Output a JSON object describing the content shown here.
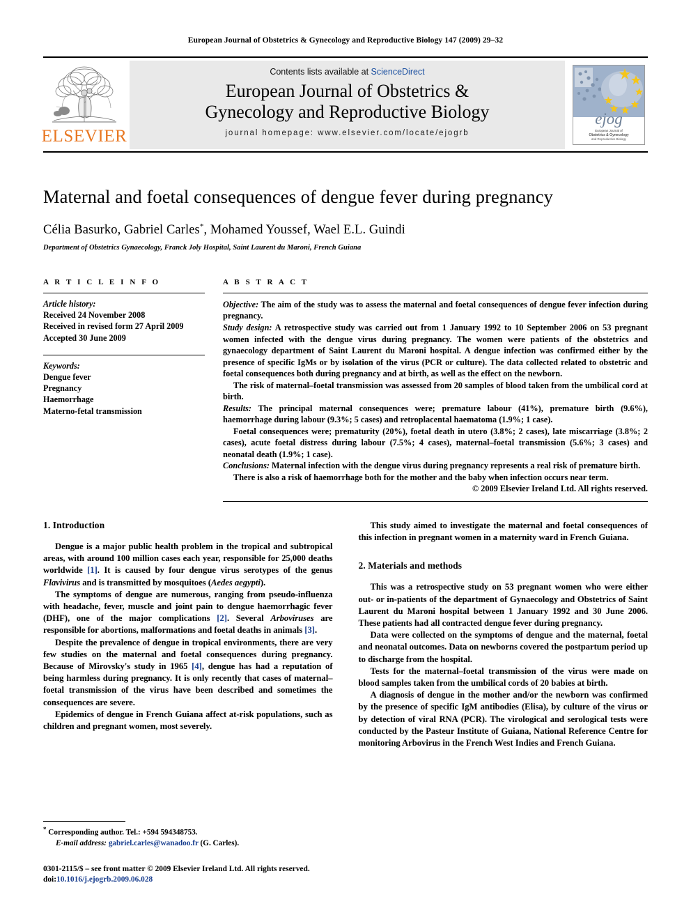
{
  "running_head": "European Journal of Obstetrics & Gynecology and Reproductive Biology 147 (2009) 29–32",
  "masthead": {
    "publisher_name": "ELSEVIER",
    "publisher_logo_icon": "elsevier-tree-logo",
    "contents_prefix": "Contents lists available at",
    "sciencedirect_label": "ScienceDirect",
    "journal_title": "European Journal of Obstetrics & Gynecology and Reproductive Biology",
    "homepage_label": "journal homepage: www.elsevier.com/locate/ejogrb",
    "cover_icon": "journal-cover-thumbnail",
    "cover_caption": "Obstetrics & Gynecology and Reproductive Biology",
    "cover_wordmark": "ejog"
  },
  "article": {
    "title": "Maternal and foetal consequences of dengue fever during pregnancy",
    "authors": "Célia Basurko, Gabriel Carles",
    "authors_marker": "*",
    "authors_rest": ", Mohamed Youssef, Wael E.L. Guindi",
    "affiliation": "Department of Obstetrics Gynaecology, Franck Joly Hospital, Saint Laurent du Maroni, French Guiana"
  },
  "article_info": {
    "heading": "A R T I C L E   I N F O",
    "history_label": "Article history:",
    "history": [
      "Received 24 November 2008",
      "Received in revised form 27 April 2009",
      "Accepted 30 June 2009"
    ],
    "keywords_label": "Keywords:",
    "keywords": [
      "Dengue fever",
      "Pregnancy",
      "Haemorrhage",
      "Materno-fetal transmission"
    ]
  },
  "abstract": {
    "heading": "A B S T R A C T",
    "objective_label": "Objective:",
    "objective_text": " The aim of the study was to assess the maternal and foetal consequences of dengue fever infection during pregnancy.",
    "study_design_label": "Study design:",
    "study_design_text": " A retrospective study was carried out from 1 January 1992 to 10 September 2006 on 53 pregnant women infected with the dengue virus during pregnancy. The women were patients of the obstetrics and gynaecology department of Saint Laurent du Maroni hospital. A dengue infection was confirmed either by the presence of specific IgMs or by isolation of the virus (PCR or culture). The data collected related to obstetric and foetal consequences both during pregnancy and at birth, as well as the effect on the newborn.",
    "study_design_para2": "The risk of maternal–foetal transmission was assessed from 20 samples of blood taken from the umbilical cord at birth.",
    "results_label": "Results:",
    "results_text": " The principal maternal consequences were; premature labour (41%), premature birth (9.6%), haemorrhage during labour (9.3%; 5 cases) and retroplacental haematoma (1.9%; 1 case).",
    "results_para2": "Foetal consequences were; prematurity (20%), foetal death in utero (3.8%; 2 cases), late miscarriage (3.8%; 2 cases), acute foetal distress during labour (7.5%; 4 cases), maternal–foetal transmission (5.6%; 3 cases) and neonatal death (1.9%; 1 case).",
    "conclusions_label": "Conclusions:",
    "conclusions_text": " Maternal infection with the dengue virus during pregnancy represents a real risk of premature birth.",
    "conclusions_para2": "There is also a risk of haemorrhage both for the mother and the baby when infection occurs near term.",
    "copyright": "© 2009 Elsevier Ireland Ltd. All rights reserved."
  },
  "body": {
    "left": {
      "section1_heading": "1. Introduction",
      "p1_a": "Dengue is a major public health problem in the tropical and subtropical areas, with around 100 million cases each year, responsible for 25,000 deaths worldwide ",
      "p1_ref": "[1]",
      "p1_b": ". It is caused by four dengue virus serotypes of the genus ",
      "p1_italic1": "Flavivirus",
      "p1_c": " and is transmitted by mosquitoes (",
      "p1_italic2": "Aedes aegypti",
      "p1_d": ").",
      "p2_a": "The symptoms of dengue are numerous, ranging from pseudo-influenza with headache, fever, muscle and joint pain to dengue haemorrhagic fever (DHF), one of the major complications ",
      "p2_ref": "[2]",
      "p2_b": ". Several ",
      "p2_italic": "Arboviruses",
      "p2_c": " are responsible for abortions, malformations and foetal deaths in animals ",
      "p2_ref2": "[3]",
      "p2_d": ".",
      "p3_a": "Despite the prevalence of dengue in tropical environments, there are very few studies on the maternal and foetal consequences during pregnancy. Because of Mirovsky's study in 1965 ",
      "p3_ref": "[4]",
      "p3_b": ", dengue has had a reputation of being harmless during pregnancy. It is only recently that cases of maternal–foetal transmission of the virus have been described and sometimes the consequences are severe.",
      "p4": "Epidemics of dengue in French Guiana affect at-risk populations, such as children and pregnant women, most severely."
    },
    "right": {
      "p1": "This study aimed to investigate the maternal and foetal consequences of this infection in pregnant women in a maternity ward in French Guiana.",
      "section2_heading": "2. Materials and methods",
      "p2": "This was a retrospective study on 53 pregnant women who were either out- or in-patients of the department of Gynaecology and Obstetrics of Saint Laurent du Maroni hospital between 1 January 1992 and 30 June 2006. These patients had all contracted dengue fever during pregnancy.",
      "p3": "Data were collected on the symptoms of dengue and the maternal, foetal and neonatal outcomes. Data on newborns covered the postpartum period up to discharge from the hospital.",
      "p4": "Tests for the maternal–foetal transmission of the virus were made on blood samples taken from the umbilical cords of 20 babies at birth.",
      "p5_a": "A diagnosis of dengue in the mother and/or the newborn was confirmed by the presence of specific IgM antibodies (Elisa), by culture of the virus or by detection of viral RNA (PCR). The virological and serological tests were conducted by the Pasteur Institute of Guiana, National Reference Centre for monitoring Arbovirus in the French West Indies and French Guiana."
    }
  },
  "footnotes": {
    "corresponding_marker": "*",
    "corresponding_text": " Corresponding author. Tel.: +594 594348753.",
    "email_label": "E-mail address:",
    "email_address": "gabriel.carles@wanadoo.fr",
    "email_suffix": " (G. Carles).",
    "imprint_line": "0301-2115/$ – see front matter © 2009 Elsevier Ireland Ltd. All rights reserved.",
    "doi_label": "doi:",
    "doi_value": "10.1016/j.ejogrb.2009.06.028"
  },
  "colors": {
    "elsevier_orange": "#E87722",
    "link_blue": "#1a3f8f",
    "sciencedirect_blue": "#1a4fa0",
    "band_gray": "#e9e9e9"
  }
}
